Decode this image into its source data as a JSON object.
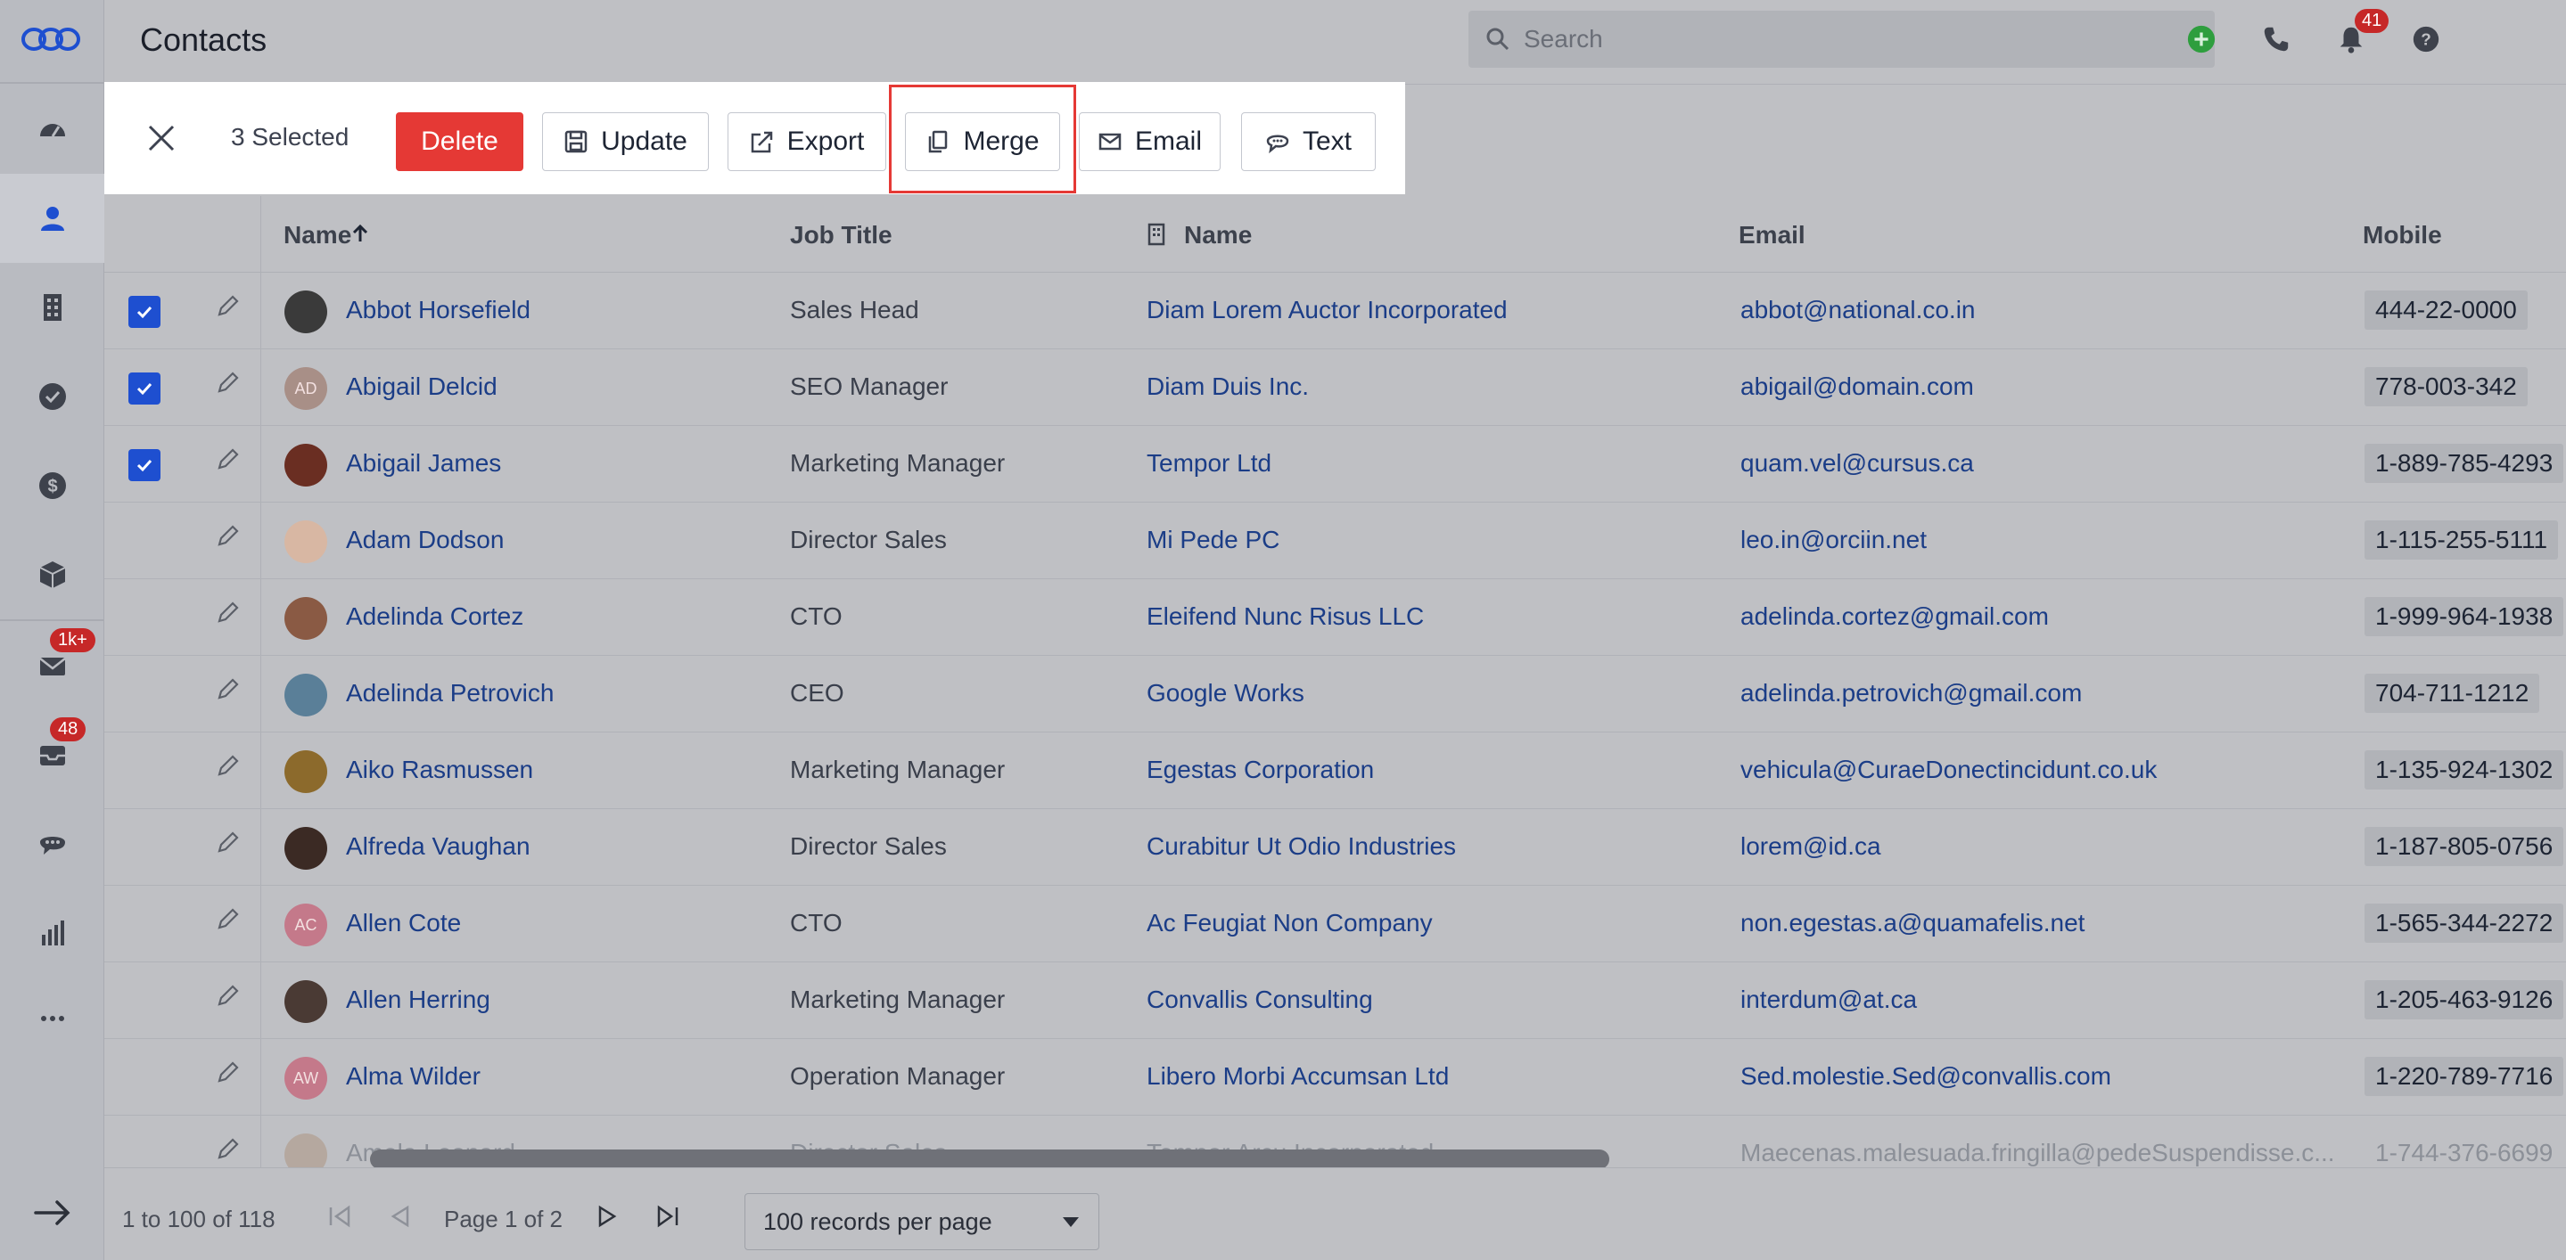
{
  "header": {
    "title": "Contacts",
    "search_placeholder": "Search",
    "notifications_count": "41"
  },
  "sidebar": {
    "items": [
      {
        "icon": "dashboard-icon"
      },
      {
        "icon": "contacts-icon",
        "active": true
      },
      {
        "icon": "accounts-icon"
      },
      {
        "icon": "tasks-icon"
      },
      {
        "icon": "deals-icon"
      },
      {
        "icon": "products-icon"
      },
      {
        "icon": "mail-icon",
        "badge": "1k+"
      },
      {
        "icon": "inbox-icon",
        "badge": "48"
      },
      {
        "icon": "chat-icon"
      },
      {
        "icon": "reports-icon"
      },
      {
        "icon": "more-icon"
      }
    ]
  },
  "action_bar": {
    "selected_label": "3 Selected",
    "delete_label": "Delete",
    "update_label": "Update",
    "export_label": "Export",
    "merge_label": "Merge",
    "email_label": "Email",
    "text_label": "Text"
  },
  "table": {
    "columns": [
      "Name",
      "Job Title",
      "Name",
      "Email",
      "Mobile"
    ],
    "rows": [
      {
        "name": "Abbot Horsefield",
        "job": "Sales Head",
        "company": "Diam Lorem Auctor Incorporated",
        "email": "abbot@national.co.in",
        "mobile": "444-22-0000",
        "checked": true,
        "initials": "",
        "avatar_color": "#3a3a3a"
      },
      {
        "name": "Abigail Delcid",
        "job": "SEO Manager",
        "company": "Diam Duis Inc.",
        "email": "abigail@domain.com",
        "mobile": "778-003-342",
        "checked": true,
        "initials": "AD",
        "avatar_color": "#a88f87"
      },
      {
        "name": "Abigail James",
        "job": "Marketing Manager",
        "company": "Tempor Ltd",
        "email": "quam.vel@cursus.ca",
        "mobile": "1-889-785-4293",
        "checked": true,
        "initials": "",
        "avatar_color": "#6a2e22"
      },
      {
        "name": "Adam Dodson",
        "job": "Director Sales",
        "company": "Mi Pede PC",
        "email": "leo.in@orciin.net",
        "mobile": "1-115-255-5111",
        "checked": false,
        "initials": "",
        "avatar_color": "#d8b7a3"
      },
      {
        "name": "Adelinda Cortez",
        "job": "CTO",
        "company": "Eleifend Nunc Risus LLC",
        "email": "adelinda.cortez@gmail.com",
        "mobile": "1-999-964-1938",
        "checked": false,
        "initials": "",
        "avatar_color": "#8a5a44"
      },
      {
        "name": "Adelinda Petrovich",
        "job": "CEO",
        "company": "Google Works",
        "email": "adelinda.petrovich@gmail.com",
        "mobile": "704-711-1212",
        "checked": false,
        "initials": "",
        "avatar_color": "#5a7f98"
      },
      {
        "name": "Aiko Rasmussen",
        "job": "Marketing Manager",
        "company": "Egestas Corporation",
        "email": "vehicula@CuraeDonectincidunt.co.uk",
        "mobile": "1-135-924-1302",
        "checked": false,
        "initials": "",
        "avatar_color": "#8c6a2c"
      },
      {
        "name": "Alfreda Vaughan",
        "job": "Director Sales",
        "company": "Curabitur Ut Odio Industries",
        "email": "lorem@id.ca",
        "mobile": "1-187-805-0756",
        "checked": false,
        "initials": "",
        "avatar_color": "#3b2a24"
      },
      {
        "name": "Allen Cote",
        "job": "CTO",
        "company": "Ac Feugiat Non Company",
        "email": "non.egestas.a@quamafelis.net",
        "mobile": "1-565-344-2272",
        "checked": false,
        "initials": "AC",
        "avatar_color": "#c4798a"
      },
      {
        "name": "Allen Herring",
        "job": "Marketing Manager",
        "company": "Convallis Consulting",
        "email": "interdum@at.ca",
        "mobile": "1-205-463-9126",
        "checked": false,
        "initials": "",
        "avatar_color": "#4a3a34"
      },
      {
        "name": "Alma Wilder",
        "job": "Operation Manager",
        "company": "Libero Morbi Accumsan Ltd",
        "email": "Sed.molestie.Sed@convallis.com",
        "mobile": "1-220-789-7716",
        "checked": false,
        "initials": "AW",
        "avatar_color": "#c4798a"
      },
      {
        "name": "Amela Leonard",
        "job": "Director Sales",
        "company": "Tempor Arcu Incorporated",
        "email": "Maecenas.malesuada.fringilla@pedeSuspendisse.c...",
        "mobile": "1-744-376-6699",
        "checked": false,
        "initials": "",
        "avatar_color": "#b5a89f"
      }
    ]
  },
  "footer": {
    "range_text": "1 to 100 of 118",
    "page_text": "Page 1 of 2",
    "per_page": "100 records per page"
  }
}
